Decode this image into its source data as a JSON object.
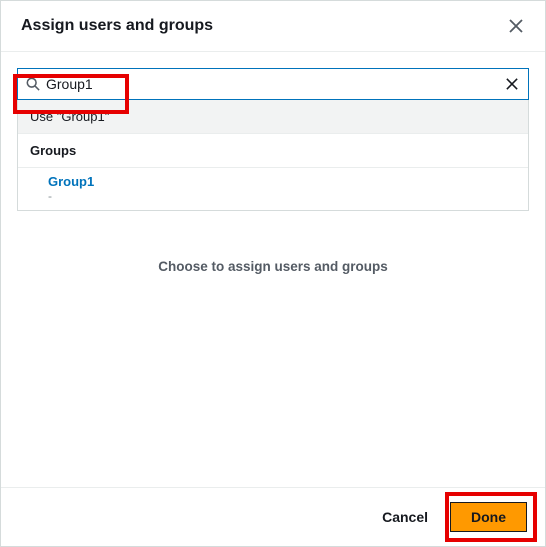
{
  "header": {
    "title": "Assign users and groups"
  },
  "search": {
    "value": "Group1"
  },
  "dropdown": {
    "use_label": "Use \"Group1\"",
    "section_label": "Groups",
    "items": [
      {
        "name": "Group1",
        "sub": "-"
      }
    ]
  },
  "empty_message": "Choose to assign users and groups",
  "footer": {
    "cancel": "Cancel",
    "done": "Done"
  }
}
